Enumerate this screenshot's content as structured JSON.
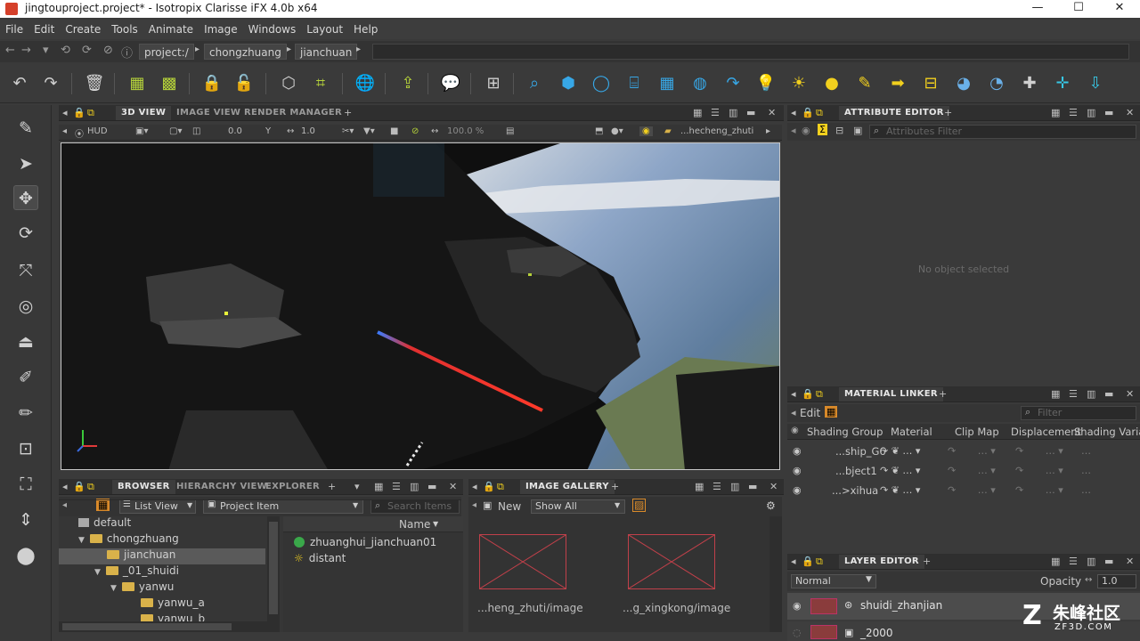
{
  "window": {
    "title": "jingtouproject.project* - Isotropix Clarisse iFX 4.0b x64",
    "controls": [
      "—",
      "☐",
      "✕"
    ]
  },
  "menu": [
    "File",
    "Edit",
    "Create",
    "Tools",
    "Animate",
    "Image",
    "Windows",
    "Layout",
    "Help"
  ],
  "path": {
    "crumbs": [
      "project:/",
      "chongzhuang",
      "jianchuan"
    ]
  },
  "viewport_panel": {
    "tabs": [
      "3D VIEW",
      "IMAGE VIEW",
      "RENDER MANAGER"
    ],
    "hud": "HUD",
    "value1": "0.0",
    "value2": "1.0",
    "zoom": "100.0 %",
    "camera_path": "...hecheng_zhuti"
  },
  "attribute_editor": {
    "title": "ATTRIBUTE EDITOR",
    "filter_placeholder": "Attributes Filter",
    "empty": "No object selected"
  },
  "material_linker": {
    "title": "MATERIAL LINKER",
    "edit": "Edit",
    "filter_placeholder": "Filter",
    "columns": [
      "Shading Group",
      "Material",
      "Clip Map",
      "Displacement",
      "Shading Variab"
    ],
    "rows": [
      "...ship_G6",
      "...bject1",
      "...>xihua"
    ]
  },
  "layer_editor": {
    "title": "LAYER EDITOR",
    "blend": "Normal",
    "opacity_label": "Opacity",
    "opacity": "1.0",
    "layers": [
      "shuidi_zhanjian",
      "_2000"
    ]
  },
  "browser": {
    "tabs": [
      "BROWSER",
      "HIERARCHY VIEW",
      "EXPLORER"
    ],
    "view_mode": "List View",
    "item_type": "Project Item",
    "search_placeholder": "Search Items",
    "column": "Name",
    "tree": [
      "default",
      "chongzhuang",
      "jianchuan",
      "_01_shuidi",
      "yanwu",
      "yanwu_a",
      "yanwu_b"
    ],
    "items": [
      "zhuanghui_jianchuan01",
      "distant"
    ]
  },
  "image_gallery": {
    "title": "IMAGE GALLERY",
    "new": "New",
    "filter": "Show All",
    "images": [
      "...heng_zhuti/image",
      "...g_xingkong/image"
    ]
  },
  "watermark": {
    "brand": "朱峰社区",
    "url": "ZF3D.COM"
  },
  "colors": {
    "accent_yellow": "#f2d01e",
    "accent_blue": "#37a7e6",
    "panel_bg": "#3a3a3a",
    "viewport_bg": "#0f0f0f"
  }
}
